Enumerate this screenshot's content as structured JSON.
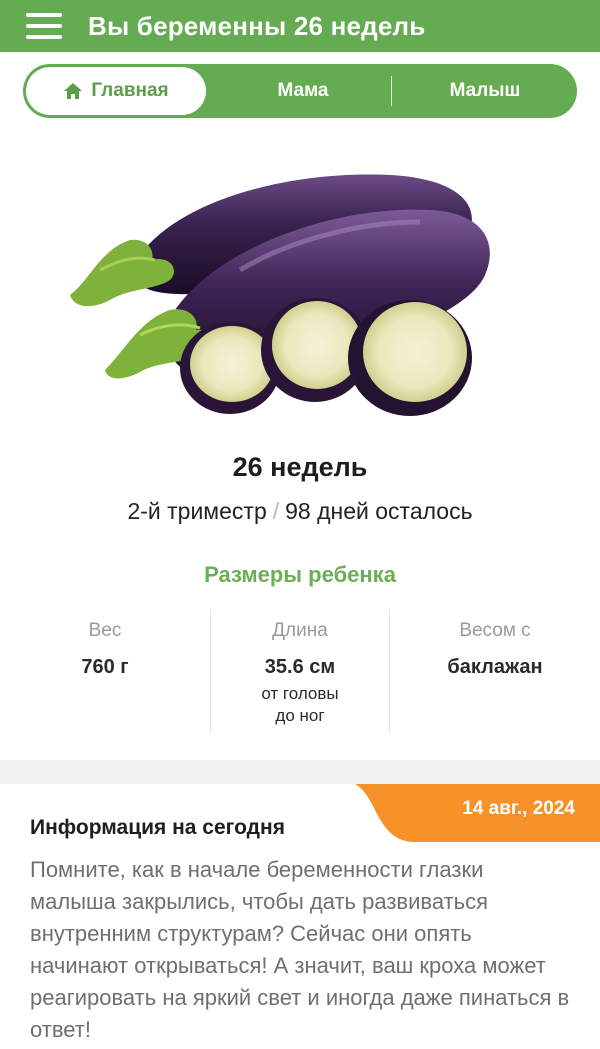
{
  "header": {
    "title": "Вы беременны 26 недель"
  },
  "tabs": [
    {
      "label": "Главная"
    },
    {
      "label": "Мама"
    },
    {
      "label": "Малыш"
    }
  ],
  "week": {
    "title": "26 недель",
    "trimester": "2-й триместр",
    "separator": "/",
    "days_left": "98 дней осталось"
  },
  "sizes": {
    "title": "Размеры ребенка",
    "weight_label": "Вес",
    "weight_value": "760 г",
    "length_label": "Длина",
    "length_value": "35.6 см",
    "length_sub_1": "от головы",
    "length_sub_2": "до ног",
    "compare_label": "Весом с",
    "compare_value": "баклажан"
  },
  "info": {
    "date": "14 авг., 2024",
    "title": "Информация на сегодня",
    "text": "Помните, как в начале беременности глазки малыша закрылись, чтобы дать развиваться внутренним структурам? Сейчас они опять начинают открываться! А значит, ваш кроха может реагировать на яркий свет и иногда даже пинаться в ответ!"
  },
  "colors": {
    "brand_green": "#64ab52",
    "accent_orange": "#f7922a",
    "sizes_title_green": "#6aae56"
  }
}
